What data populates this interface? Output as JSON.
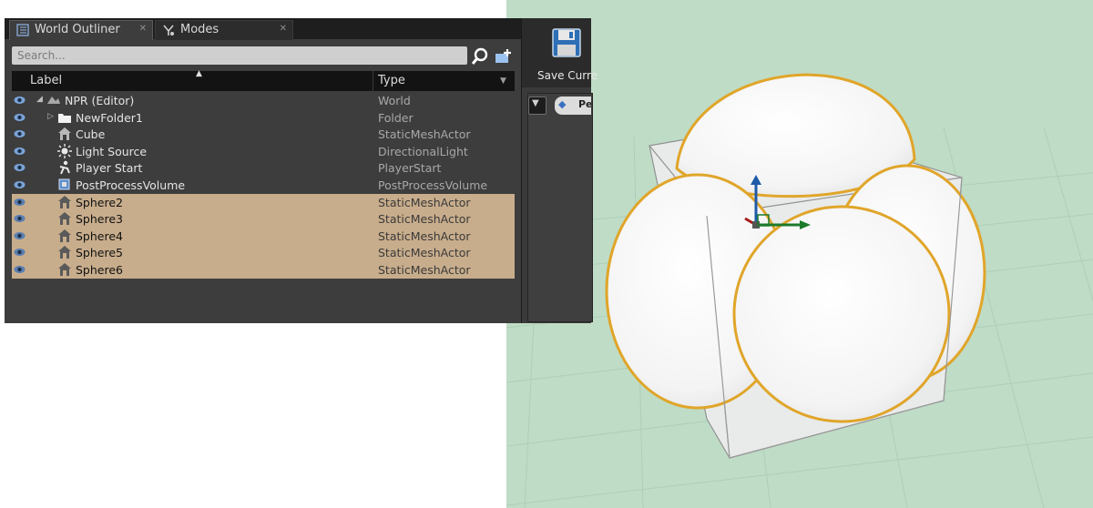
{
  "tabs": [
    {
      "label": "World Outliner",
      "icon": "list-icon"
    },
    {
      "label": "Modes",
      "icon": "modes-icon"
    }
  ],
  "search": {
    "placeholder": "Search..."
  },
  "columns": {
    "label": "Label",
    "type": "Type"
  },
  "rows": [
    {
      "name": "NPR (Editor)",
      "type": "World",
      "icon": "world-icon",
      "selected": false
    },
    {
      "name": "NewFolder1",
      "type": "Folder",
      "icon": "folder-icon",
      "selected": false
    },
    {
      "name": "Cube",
      "type": "StaticMeshActor",
      "icon": "static-mesh-icon",
      "selected": false
    },
    {
      "name": "Light Source",
      "type": "DirectionalLight",
      "icon": "directional-light-icon",
      "selected": false
    },
    {
      "name": "Player Start",
      "type": "PlayerStart",
      "icon": "player-start-icon",
      "selected": false
    },
    {
      "name": "PostProcessVolume",
      "type": "PostProcessVolume",
      "icon": "post-process-icon",
      "selected": false
    },
    {
      "name": "Sphere2",
      "type": "StaticMeshActor",
      "icon": "static-mesh-icon",
      "selected": true
    },
    {
      "name": "Sphere3",
      "type": "StaticMeshActor",
      "icon": "static-mesh-icon",
      "selected": true
    },
    {
      "name": "Sphere4",
      "type": "StaticMeshActor",
      "icon": "static-mesh-icon",
      "selected": true
    },
    {
      "name": "Sphere5",
      "type": "StaticMeshActor",
      "icon": "static-mesh-icon",
      "selected": true
    },
    {
      "name": "Sphere6",
      "type": "StaticMeshActor",
      "icon": "static-mesh-icon",
      "selected": true
    }
  ],
  "toolbar": {
    "save_label": "Save Curre",
    "perspective_label": "Pe"
  },
  "colors": {
    "selection": "#c8ad8c",
    "viewport_bg": "#bfdcc6",
    "highlight_outline": "#e0a52a"
  }
}
